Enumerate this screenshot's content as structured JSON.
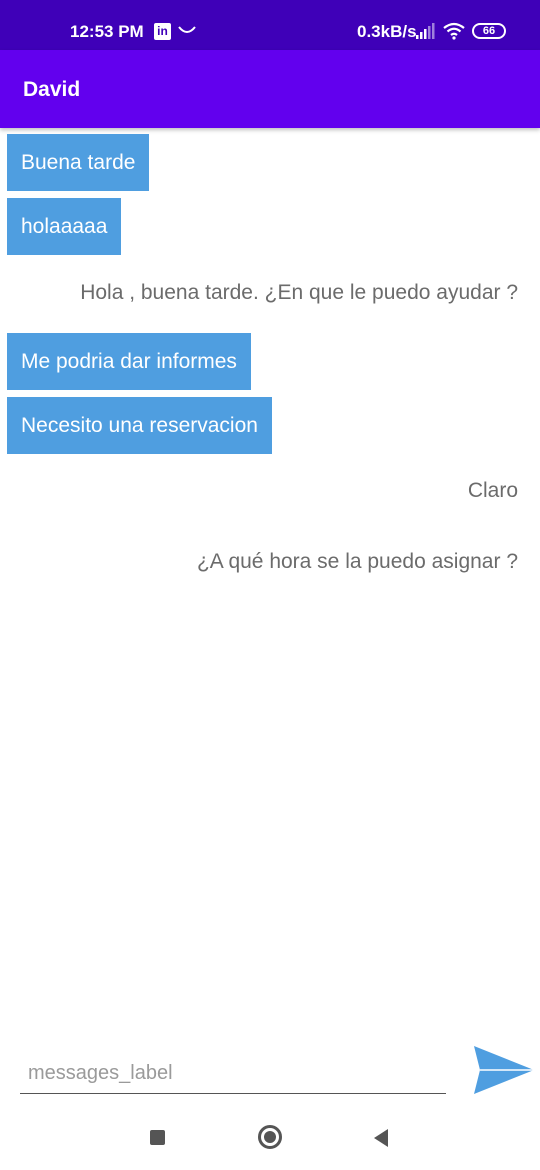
{
  "status_bar": {
    "time": "12:53 PM",
    "linkedin_badge": "in",
    "speed": "0.3kB/s",
    "battery": "66"
  },
  "app_bar": {
    "title": "David"
  },
  "messages": [
    {
      "side": "sent",
      "text": "Buena tarde"
    },
    {
      "side": "sent",
      "text": "holaaaaa"
    },
    {
      "side": "received",
      "text": "Hola , buena tarde. ¿En que le puedo ayudar ?"
    },
    {
      "side": "sent",
      "text": "Me podria dar informes"
    },
    {
      "side": "sent",
      "text": "Necesito una reservacion"
    },
    {
      "side": "received",
      "text": "Claro"
    },
    {
      "side": "received",
      "text": "¿A qué hora se la puedo asignar ?"
    }
  ],
  "composer": {
    "placeholder": "messages_label",
    "value": "",
    "send_icon": "send-icon"
  },
  "colors": {
    "status_bar": "#3f00b8",
    "app_bar": "#6200ee",
    "sent_bubble": "#4f9ee0",
    "send_icon": "#4f9ee0"
  }
}
